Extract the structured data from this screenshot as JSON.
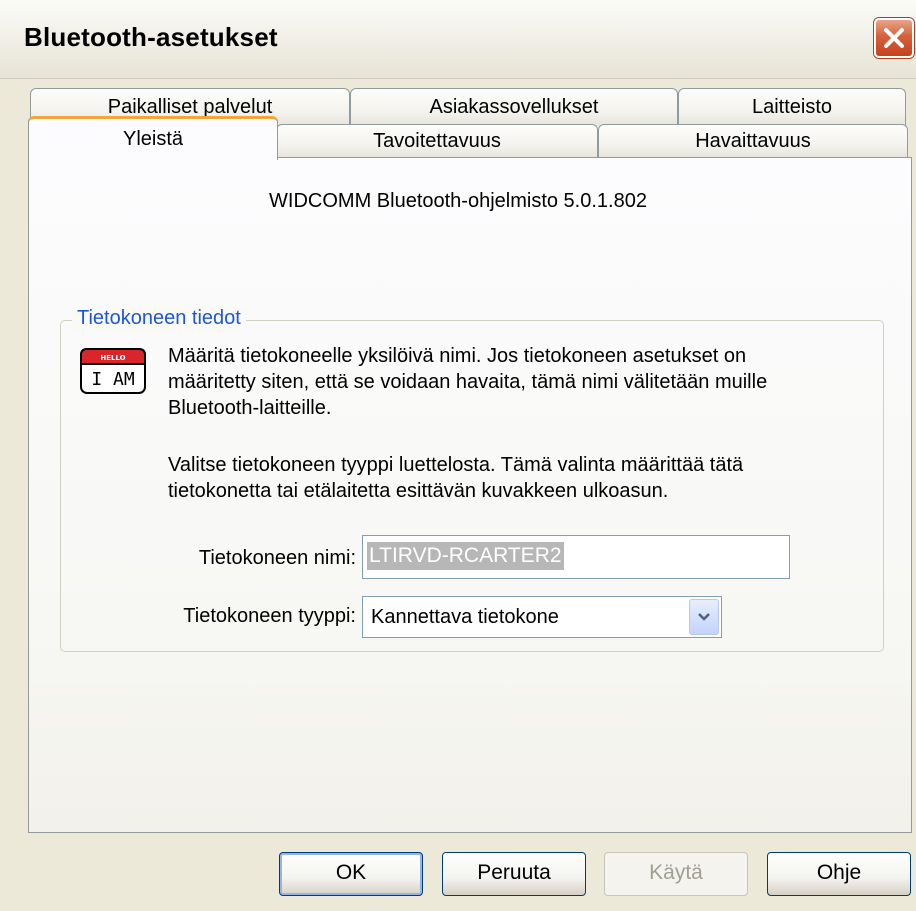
{
  "window": {
    "title": "Bluetooth-asetukset"
  },
  "tabs": {
    "row1": [
      {
        "label": "Paikalliset palvelut"
      },
      {
        "label": "Asiakassovellukset"
      },
      {
        "label": "Laitteisto"
      }
    ],
    "row2": [
      {
        "label": "Yleistä",
        "active": true
      },
      {
        "label": "Tavoitettavuus"
      },
      {
        "label": "Havaittavuus"
      }
    ]
  },
  "general": {
    "version_text": "WIDCOMM Bluetooth-ohjelmisto 5.0.1.802",
    "group_title": "Tietokoneen tiedot",
    "icon": {
      "name": "hello-i-am-badge-icon",
      "hello_text": "HELLO",
      "iam_text": "I AM"
    },
    "desc1": [
      "Määritä tietokoneelle yksilöivä nimi. Jos tietokoneen asetukset on",
      "määritetty siten, että se voidaan havaita, tämä nimi välitetään muille",
      "Bluetooth-laitteille."
    ],
    "desc2": [
      "Valitse tietokoneen tyyppi luettelosta. Tämä valinta määrittää tätä",
      "tietokonetta tai etälaitetta esittävän kuvakkeen ulkoasun."
    ],
    "name_label": "Tietokoneen nimi:",
    "name_value": "LTIRVD-RCARTER2",
    "type_label": "Tietokoneen tyyppi:",
    "type_value": "Kannettava tietokone"
  },
  "buttons": {
    "ok": "OK",
    "cancel": "Peruuta",
    "apply": "Käytä",
    "help": "Ohje"
  },
  "colors": {
    "dialog_bg": "#ECE9D8",
    "group_title": "#1E57D6",
    "active_tab_accent": "#F1A53B",
    "close_button": "#D5613C"
  }
}
